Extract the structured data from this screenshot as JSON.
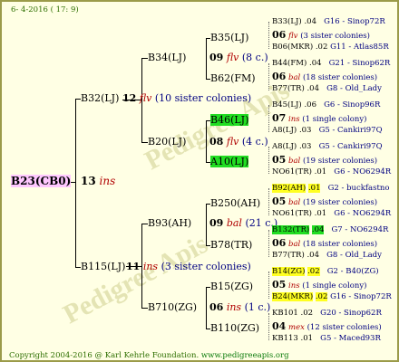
{
  "header": {
    "date": "6- 4-2016 ( 17: 9)"
  },
  "footer": {
    "copyright": "Copyright 2004-2016 @ Karl Kehrle Foundation.",
    "website": "www.pedigreeapis.org"
  },
  "root": {
    "name": "B23(CB0)",
    "count": "13",
    "location": "ins"
  },
  "gen2": [
    {
      "name": "B32(LJ)",
      "count": "12",
      "location": "flv",
      "sisters": "(10 sister colonies)"
    },
    {
      "name": "B115(LJ)",
      "count": "11",
      "location": "ins",
      "sisters": "(3 sister colonies)"
    }
  ],
  "gen3": [
    {
      "name": "B34(LJ)",
      "count": "09",
      "location": "flv",
      "sisters": "(8 c.)"
    },
    {
      "name": "B20(LJ)",
      "count": "08",
      "location": "flv",
      "sisters": "(4 c.)"
    },
    {
      "name": "B93(AH)",
      "count": "09",
      "location": "bal",
      "sisters": "(21 c.)"
    },
    {
      "name": "B710(ZG)",
      "count": "06",
      "location": "ins",
      "sisters": "(1 c.)"
    }
  ],
  "gen4": [
    {
      "name": "B35(LJ)"
    },
    {
      "name": "B62(FM)"
    },
    {
      "name": "B46(LJ)"
    },
    {
      "name": "A10(LJ)"
    },
    {
      "name": "B250(AH)"
    },
    {
      "name": "B78(TR)"
    },
    {
      "name": "B15(ZG)"
    },
    {
      "name": "B110(ZG)"
    }
  ],
  "m4": [
    {
      "count": "06",
      "location": "flv",
      "sisters": "(3 sister colonies)"
    },
    {
      "count": "06",
      "location": "bal",
      "sisters": "(18 sister colonies)"
    },
    {
      "count": "07",
      "location": "ins",
      "sisters": "(1 single colony)"
    },
    {
      "count": "05",
      "location": "bal",
      "sisters": "(19 sister colonies)"
    },
    {
      "count": "05",
      "location": "bal",
      "sisters": "(19 sister colonies)"
    },
    {
      "count": "06",
      "location": "bal",
      "sisters": "(18 sister colonies)"
    },
    {
      "count": "05",
      "location": "ins",
      "sisters": "(1 single colony)"
    },
    {
      "count": "04",
      "location": "mex",
      "sisters": "(12 sister colonies)"
    }
  ],
  "g5": [
    {
      "name": "B33(LJ)",
      "year": ".04",
      "id": "G16 - Sinop72R"
    },
    {
      "name": "B06(MKR)",
      "year": ".02",
      "id": "G11 - Atlas85R"
    },
    {
      "name": "B44(FM)",
      "year": ".04",
      "id": "G21 - Sinop62R"
    },
    {
      "name": "B77(TR)",
      "year": ".04",
      "id": "G8 - Old_Lady"
    },
    {
      "name": "B45(LJ)",
      "year": ".06",
      "id": "G6 - Sinop96R"
    },
    {
      "name": "A8(LJ)",
      "year": ".03",
      "id": "G5 - Cankiri97Q"
    },
    {
      "name": "A8(LJ)",
      "year": ".03",
      "id": "G5 - Cankiri97Q"
    },
    {
      "name": "NO61(TR)",
      "year": ".01",
      "id": "G6 - NO6294R"
    },
    {
      "name": "B92(AH)",
      "year": ".01",
      "id": "G2 - buckfastno"
    },
    {
      "name": "NO61(TR)",
      "year": ".01",
      "id": "G6 - NO6294R"
    },
    {
      "name": "B132(TR)",
      "year": ".04",
      "id": "G7 - NO6294R"
    },
    {
      "name": "B77(TR)",
      "year": ".04",
      "id": "G8 - Old_Lady"
    },
    {
      "name": "B14(ZG)",
      "year": ".02",
      "id": "G2 - B40(ZG)"
    },
    {
      "name": "B24(MKR)",
      "year": ".02",
      "id": "G16 - Sinop72R"
    },
    {
      "name": "KB101",
      "year": ".02",
      "id": "G20 - Sinop62R"
    },
    {
      "name": "KB113",
      "year": ".01",
      "id": "G5 - Maced93R"
    }
  ]
}
